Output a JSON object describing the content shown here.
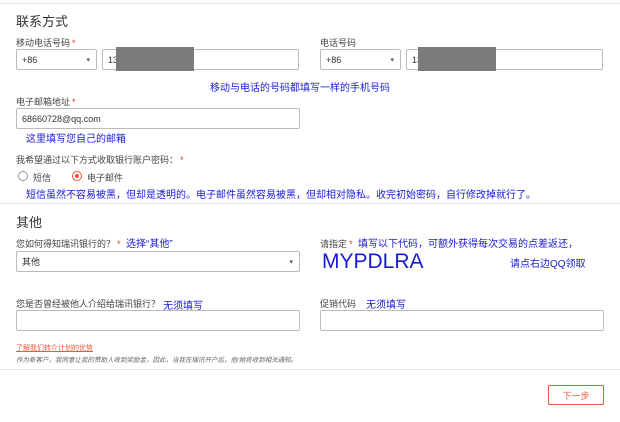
{
  "contact": {
    "section_title": "联系方式",
    "mobile_label": "移动电话号码",
    "mobile_code": "+86",
    "mobile_value": "13",
    "phone_label": "电话号码",
    "phone_code": "+86",
    "phone_value": "13",
    "phone_note": "移动与电话的号码都填写一样的手机号码",
    "email_label": "电子邮箱地址",
    "email_value": "68660728@qq.com",
    "email_note": "这里填写您自己的邮箱",
    "password_question": "我希望通过以下方式收取银行账户密码：",
    "option_sms": "短信",
    "option_email": "电子邮件",
    "password_note": "短信虽然不容易被黑，但却是透明的。电子邮件虽然容易被黑，但却相对隐私。收完初始密码，自行修改掉就行了。"
  },
  "other": {
    "section_title": "其他",
    "source_label": "您如何得知瑞讯银行的？",
    "source_note": "选择“其他”",
    "source_value": "其他",
    "specify_label": "请指定",
    "specify_note": "填写以下代码，可额外获得每次交易的点差返还，",
    "specify_value": "MYPDLRA",
    "specify_note2": "请点右边QQ领取",
    "referral_label": "您是否曾经被他人介绍给瑞讯银行？",
    "referral_note": "无须填写",
    "promo_label": "促销代码",
    "promo_note": "无须填写",
    "learn_link": "了解我们转介计划的优势",
    "learn_desc": "作为新客户，我同意让我的赞助人收到奖励金，因此，当我在瑞讯开户后，他/她将收到相关通知。"
  },
  "footer": {
    "next_button": "下一步"
  },
  "colors": {
    "annotation": "#1a1ad6",
    "accent": "#e8593c",
    "required": "#d33333"
  }
}
